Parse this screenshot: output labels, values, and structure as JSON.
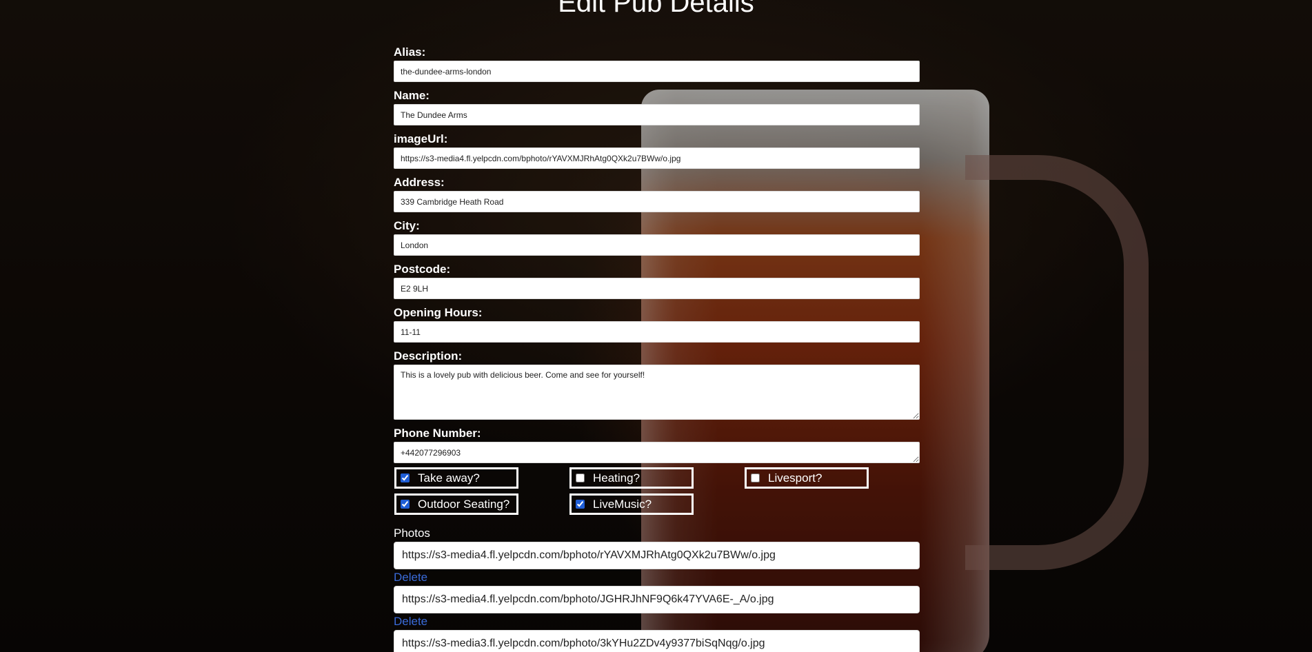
{
  "page": {
    "title": "Edit Pub Details"
  },
  "form": {
    "fields": [
      {
        "label": "Alias:",
        "value": "the-dundee-arms-london"
      },
      {
        "label": "Name:",
        "value": "The Dundee Arms"
      },
      {
        "label": "imageUrl:",
        "value": "https://s3-media4.fl.yelpcdn.com/bphoto/rYAVXMJRhAtg0QXk2u7BWw/o.jpg"
      },
      {
        "label": "Address:",
        "value": "339 Cambridge Heath Road"
      },
      {
        "label": "City:",
        "value": "London"
      },
      {
        "label": "Postcode:",
        "value": "E2 9LH"
      },
      {
        "label": "Opening Hours:",
        "value": "11-11"
      }
    ],
    "description": {
      "label": "Description:",
      "value": "This is a lovely pub with delicious beer. Come and see for yourself!"
    },
    "phone": {
      "label": "Phone Number:",
      "value": "+442077296903"
    },
    "checkboxes": [
      {
        "label": "Take away?",
        "checked": true
      },
      {
        "label": "Heating?",
        "checked": false
      },
      {
        "label": "Livesport?",
        "checked": false
      },
      {
        "label": "Outdoor Seating?",
        "checked": true
      },
      {
        "label": "LiveMusic?",
        "checked": true
      }
    ]
  },
  "photos": {
    "label": "Photos",
    "delete_label": "Delete",
    "items": [
      "https://s3-media4.fl.yelpcdn.com/bphoto/rYAVXMJRhAtg0QXk2u7BWw/o.jpg",
      "https://s3-media4.fl.yelpcdn.com/bphoto/JGHRJhNF9Q6k47YVA6E-_A/o.jpg",
      "https://s3-media3.fl.yelpcdn.com/bphoto/3kYHu2ZDv4y9377biSqNqg/o.jpg"
    ]
  }
}
